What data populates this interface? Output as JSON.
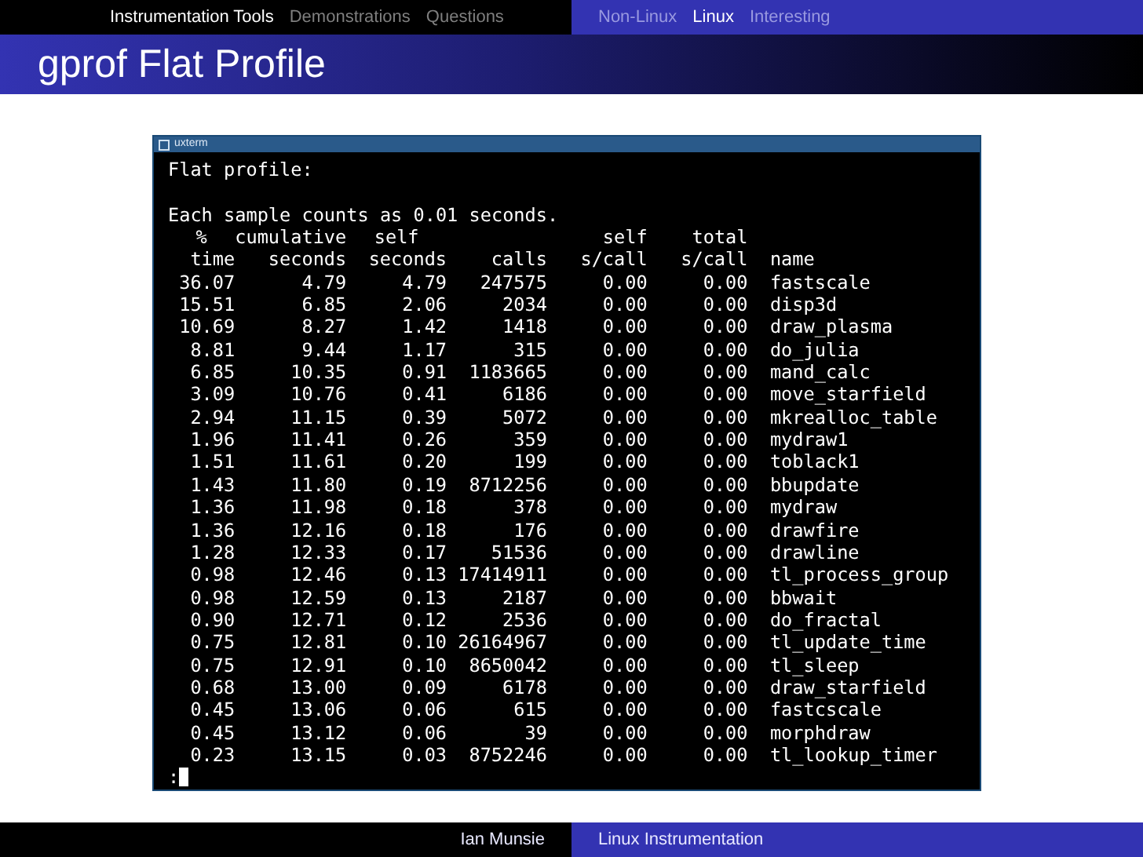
{
  "nav": {
    "sections": [
      {
        "label": "Instrumentation Tools",
        "selected": true
      },
      {
        "label": "Demonstrations",
        "selected": false
      },
      {
        "label": "Questions",
        "selected": false
      }
    ],
    "subsections": [
      {
        "label": "Non-Linux",
        "selected": false
      },
      {
        "label": "Linux",
        "selected": true
      },
      {
        "label": "Interesting",
        "selected": false
      }
    ]
  },
  "frame_title": "gprof Flat Profile",
  "terminal": {
    "title": "uxterm",
    "heading": "Flat profile:",
    "note": "Each sample counts as 0.01 seconds.",
    "header_rows": [
      [
        "%",
        "cumulative",
        "self",
        "",
        "self",
        "total",
        ""
      ],
      [
        "time",
        "seconds",
        "seconds",
        "calls",
        "s/call",
        "s/call",
        "name"
      ]
    ],
    "rows": [
      [
        "36.07",
        "4.79",
        "4.79",
        "247575",
        "0.00",
        "0.00",
        "fastscale"
      ],
      [
        "15.51",
        "6.85",
        "2.06",
        "2034",
        "0.00",
        "0.00",
        "disp3d"
      ],
      [
        "10.69",
        "8.27",
        "1.42",
        "1418",
        "0.00",
        "0.00",
        "draw_plasma"
      ],
      [
        "8.81",
        "9.44",
        "1.17",
        "315",
        "0.00",
        "0.00",
        "do_julia"
      ],
      [
        "6.85",
        "10.35",
        "0.91",
        "1183665",
        "0.00",
        "0.00",
        "mand_calc"
      ],
      [
        "3.09",
        "10.76",
        "0.41",
        "6186",
        "0.00",
        "0.00",
        "move_starfield"
      ],
      [
        "2.94",
        "11.15",
        "0.39",
        "5072",
        "0.00",
        "0.00",
        "mkrealloc_table"
      ],
      [
        "1.96",
        "11.41",
        "0.26",
        "359",
        "0.00",
        "0.00",
        "mydraw1"
      ],
      [
        "1.51",
        "11.61",
        "0.20",
        "199",
        "0.00",
        "0.00",
        "toblack1"
      ],
      [
        "1.43",
        "11.80",
        "0.19",
        "8712256",
        "0.00",
        "0.00",
        "bbupdate"
      ],
      [
        "1.36",
        "11.98",
        "0.18",
        "378",
        "0.00",
        "0.00",
        "mydraw"
      ],
      [
        "1.36",
        "12.16",
        "0.18",
        "176",
        "0.00",
        "0.00",
        "drawfire"
      ],
      [
        "1.28",
        "12.33",
        "0.17",
        "51536",
        "0.00",
        "0.00",
        "drawline"
      ],
      [
        "0.98",
        "12.46",
        "0.13",
        "17414911",
        "0.00",
        "0.00",
        "tl_process_group"
      ],
      [
        "0.98",
        "12.59",
        "0.13",
        "2187",
        "0.00",
        "0.00",
        "bbwait"
      ],
      [
        "0.90",
        "12.71",
        "0.12",
        "2536",
        "0.00",
        "0.00",
        "do_fractal"
      ],
      [
        "0.75",
        "12.81",
        "0.10",
        "26164967",
        "0.00",
        "0.00",
        "tl_update_time"
      ],
      [
        "0.75",
        "12.91",
        "0.10",
        "8650042",
        "0.00",
        "0.00",
        "tl_sleep"
      ],
      [
        "0.68",
        "13.00",
        "0.09",
        "6178",
        "0.00",
        "0.00",
        "draw_starfield"
      ],
      [
        "0.45",
        "13.06",
        "0.06",
        "615",
        "0.00",
        "0.00",
        "fastcscale"
      ],
      [
        "0.45",
        "13.12",
        "0.06",
        "39",
        "0.00",
        "0.00",
        "morphdraw"
      ],
      [
        "0.23",
        "13.15",
        "0.03",
        "8752246",
        "0.00",
        "0.00",
        "tl_lookup_timer"
      ]
    ],
    "prompt": ":"
  },
  "footer": {
    "author": "Ian Munsie",
    "title": "Linux Instrumentation"
  }
}
